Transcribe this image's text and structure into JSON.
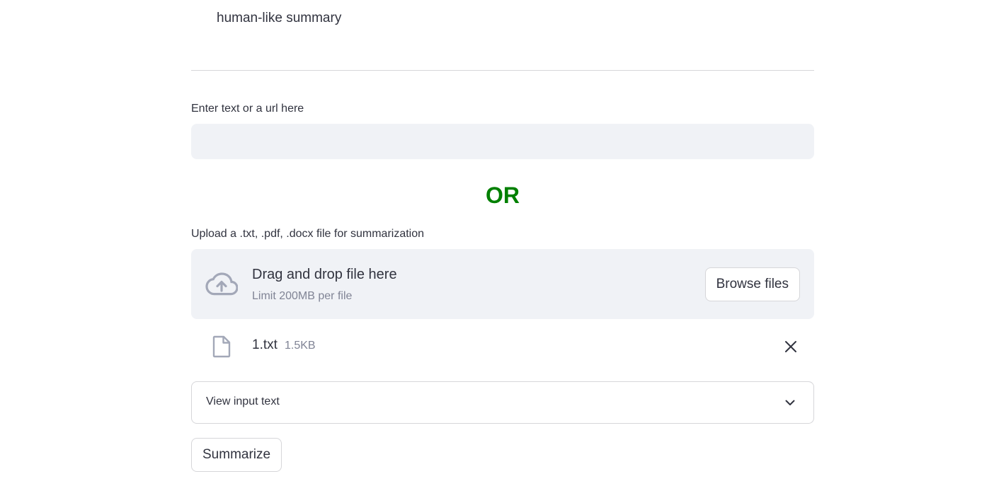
{
  "intro": {
    "line_partial": "human-like summary"
  },
  "text_input": {
    "label": "Enter text or a url here",
    "value": "",
    "placeholder": ""
  },
  "separator": {
    "text": "OR",
    "color": "#008000"
  },
  "uploader": {
    "label": "Upload a .txt, .pdf, .docx file for summarization",
    "drop_text": "Drag and drop file here",
    "limit_text": "Limit 200MB per file",
    "browse_label": "Browse files",
    "icon": "cloud-upload-icon"
  },
  "uploaded_file": {
    "name": "1.txt",
    "size": "1.5KB",
    "icon": "file-icon",
    "remove_icon": "close-icon"
  },
  "expander": {
    "label": "View input text",
    "expanded": false,
    "icon": "chevron-down-icon"
  },
  "actions": {
    "summarize_label": "Summarize"
  }
}
